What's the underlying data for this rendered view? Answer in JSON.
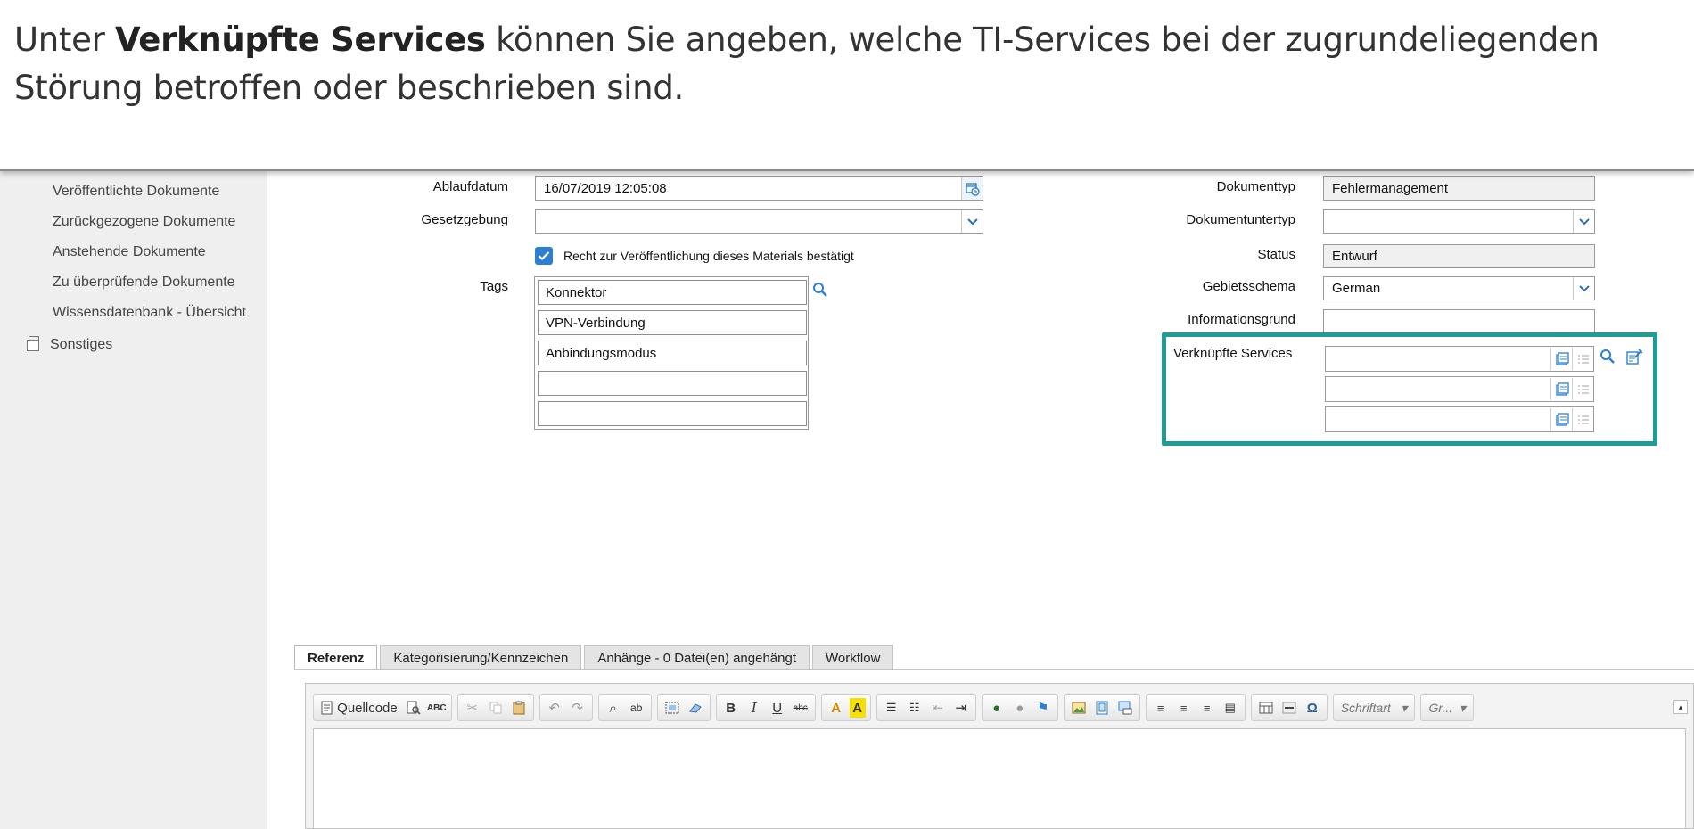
{
  "banner": {
    "part1": "Unter ",
    "bold": "Verknüpfte Services",
    "part2": " können Sie angeben, welche TI-Services bei der zugrundeliegenden Störung betroffen oder beschrieben sind."
  },
  "sidebar": {
    "items": [
      "Veröffentlichte Dokumente",
      "Zurückgezogene Dokumente",
      "Anstehende Dokumente",
      "Zu überprüfende Dokumente",
      "Wissensdatenbank - Übersicht"
    ],
    "group_label": "Sonstiges"
  },
  "form": {
    "ablaufdatum": {
      "label": "Ablaufdatum",
      "value": "16/07/2019 12:05:08"
    },
    "gesetzgebung": {
      "label": "Gesetzgebung",
      "value": ""
    },
    "recht_checkbox": {
      "label": "Recht zur Veröffentlichung dieses Materials bestätigt",
      "checked": true
    },
    "tags": {
      "label": "Tags",
      "values": [
        "Konnektor",
        "VPN-Verbindung",
        "Anbindungsmodus",
        "",
        ""
      ]
    },
    "dokumenttyp": {
      "label": "Dokumenttyp",
      "value": "Fehlermanagement"
    },
    "dokumentuntertyp": {
      "label": "Dokumentuntertyp",
      "value": ""
    },
    "status": {
      "label": "Status",
      "value": "Entwurf"
    },
    "gebietsschema": {
      "label": "Gebietsschema",
      "value": "German"
    },
    "informationsgrund": {
      "label": "Informationsgrund",
      "value": ""
    },
    "verknuepfte_services": {
      "label": "Verknüpfte Services",
      "values": [
        "",
        "",
        ""
      ]
    }
  },
  "tabs": [
    "Referenz",
    "Kategorisierung/Kennzeichen",
    "Anhänge  - 0 Datei(en) angehängt",
    "Workflow"
  ],
  "editor": {
    "source_label": "Quellcode",
    "font_combo": "Schriftart",
    "size_combo": "Gr..."
  },
  "colors": {
    "highlight": "#1f9c94",
    "accent_blue": "#2d7fd3",
    "sidebar_bg": "#efefef"
  }
}
